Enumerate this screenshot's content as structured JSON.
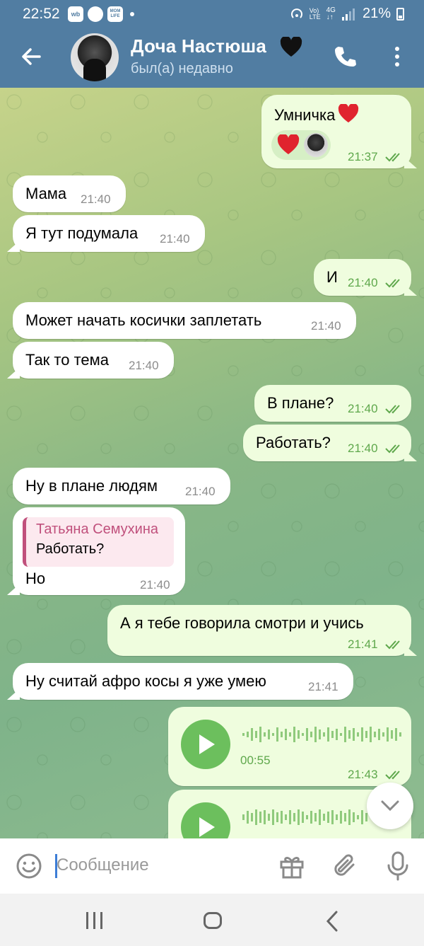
{
  "status_bar": {
    "time": "22:52",
    "app_icons": [
      "wb",
      "max-app-icon",
      "MOM LIFE"
    ],
    "network": "Vo) LTE 4G",
    "battery": "21%"
  },
  "header": {
    "name": "Доча Настюша",
    "name_emoji": "black-heart-icon",
    "status": "был(а) недавно"
  },
  "messages": [
    {
      "dir": "out",
      "text": "Умничка",
      "emoji": "red-heart-icon",
      "time": "21:37",
      "reaction": "red-heart-icon"
    },
    {
      "dir": "in",
      "text": "Мама",
      "time": "21:40"
    },
    {
      "dir": "in",
      "text": "Я тут подумала",
      "time": "21:40"
    },
    {
      "dir": "out",
      "text": "И",
      "time": "21:40"
    },
    {
      "dir": "in",
      "text": "Может начать косички заплетать",
      "time": "21:40"
    },
    {
      "dir": "in",
      "text": "Так то тема",
      "time": "21:40"
    },
    {
      "dir": "out",
      "text": "В плане?",
      "time": "21:40"
    },
    {
      "dir": "out",
      "text": "Работать?",
      "time": "21:40"
    },
    {
      "dir": "in",
      "text": "Ну в плане людям",
      "time": "21:40"
    },
    {
      "dir": "in",
      "text": "Но",
      "time": "21:40",
      "quote": {
        "name": "Татьяна Семухина",
        "text": "Работать?"
      }
    },
    {
      "dir": "out",
      "text": "А я тебе говорила смотри и учись",
      "time": "21:41"
    },
    {
      "dir": "in",
      "text": "Ну считай афро косы я уже умею",
      "time": "21:41"
    },
    {
      "dir": "out",
      "type": "voice",
      "duration": "00:55",
      "time": "21:43"
    },
    {
      "dir": "out",
      "type": "voice"
    }
  ],
  "input": {
    "placeholder": "Сообщение"
  },
  "colors": {
    "header": "#517da2",
    "outgoing": "#effdde",
    "incoming": "#ffffff",
    "accent_green": "#5fa84c",
    "play_button": "#6cbf5d",
    "quote_accent": "#c0507c"
  }
}
